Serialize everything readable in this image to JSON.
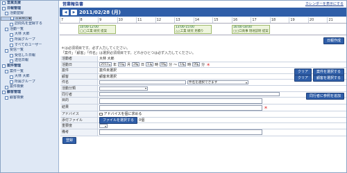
{
  "sidebar": {
    "items": [
      {
        "label": "営業支援",
        "level": 0
      },
      {
        "label": "日報管理",
        "level": 0
      },
      {
        "label": "活動登録",
        "level": 1
      },
      {
        "label": "営業報告書",
        "level": 2,
        "selected": true
      },
      {
        "label": "訪問先を登録する",
        "level": 2
      },
      {
        "label": "活動一覧",
        "level": 1
      },
      {
        "label": "大林 大郎",
        "level": 2
      },
      {
        "label": "所属グループ",
        "level": 2
      },
      {
        "label": "すべてのユーザー",
        "level": 2
      },
      {
        "label": "受信一覧",
        "level": 1
      },
      {
        "label": "受信した日報",
        "level": 2
      },
      {
        "label": "送信日報",
        "level": 2
      },
      {
        "label": "案件管理",
        "level": 0
      },
      {
        "label": "案件一覧",
        "level": 1
      },
      {
        "label": "大林 大郎",
        "level": 2
      },
      {
        "label": "所属グループ",
        "level": 2
      },
      {
        "label": "案件検索",
        "level": 1
      },
      {
        "label": "顧客管理",
        "level": 0
      },
      {
        "label": "顧客検索",
        "level": 1
      }
    ]
  },
  "header": {
    "title": "営業報告書",
    "calendar_link": "カレンダーを表示にする"
  },
  "datebar": {
    "prev": "◀",
    "next": "▶",
    "date": "2011/02/28 (月)"
  },
  "hours": [
    "7",
    "8",
    "9",
    "10",
    "11",
    "12",
    "13",
    "14",
    "15",
    "16",
    "17",
    "18",
    "19",
    "20",
    "21"
  ],
  "events": [
    {
      "time": "10:00-12:00",
      "text": "◯◯工業 研究 提案"
    },
    {
      "time": "13:00-15:00",
      "text": "△△工業 研究 見積り"
    },
    {
      "time": "16:00-18:00",
      "text": "□□口商事 現地説明 提案"
    }
  ],
  "actions": {
    "register_daily": "日報作成"
  },
  "notes": [
    "＊は必須項目です。必ず入力してください。",
    "「案件」「顧客」「件名」は選択必須項目です。どれかひとつは必ず入力してください。"
  ],
  "form": {
    "activity_person": {
      "label": "活動者",
      "value": "大林 大郎"
    },
    "activity_date": {
      "label": "活動日",
      "year": "2011",
      "year_unit": "年",
      "month": "02",
      "month_unit": "月",
      "day": "28",
      "day_unit": "日",
      "hour1": "13",
      "hour1_unit": "時",
      "min1": "00",
      "min1_unit": "分",
      "tilde": "〜",
      "hour2": "14",
      "hour2_unit": "時",
      "min2": "00",
      "min2_unit": "分",
      "req": "＊"
    },
    "project": {
      "label": "案件",
      "value": "案件未選択",
      "clear": "クリア",
      "select": "案件を選択する"
    },
    "customer": {
      "label": "顧客",
      "value": "顧客未選択",
      "clear": "クリア",
      "select": "顧客を選択する"
    },
    "subject": {
      "label": "件名",
      "select_value": "件名を選択できます"
    },
    "activity_type": {
      "label": "活動分類"
    },
    "companion": {
      "label": "同行者",
      "button": "同行者に参照を追加"
    },
    "purpose": {
      "label": "目的"
    },
    "result": {
      "label": "結果",
      "req": "＊"
    },
    "advice": {
      "label": "アドバイス",
      "checkbox": "アドバイスを個に求める"
    },
    "attachment": {
      "label": "添付ファイル",
      "button": "ファイルを選択する",
      "count": "0個"
    },
    "importance": {
      "label": "重要度"
    },
    "remarks": {
      "label": "備考"
    }
  },
  "footer": {
    "submit": "登録"
  }
}
